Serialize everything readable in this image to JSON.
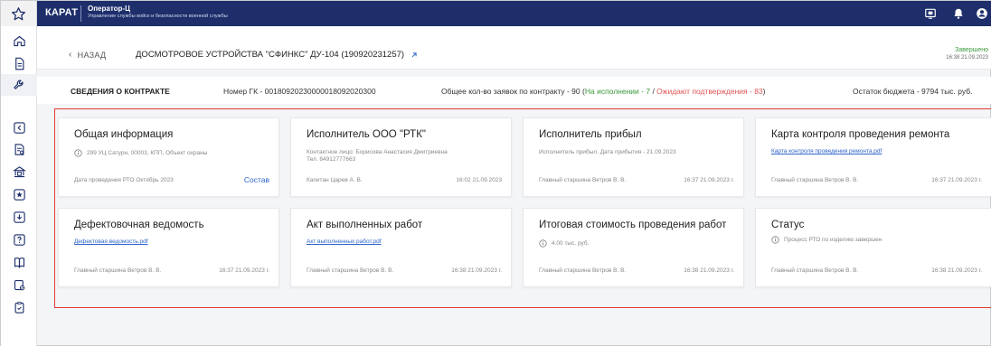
{
  "brand": "КАРАТ",
  "app": {
    "title": "Оператор-Ц",
    "subtitle": "Управление службы войск и безопасности военной службы"
  },
  "header": {
    "back_label": "НАЗАД",
    "title": "ДОСМОТРОВОЕ УСТРОЙСТВА \"СФИНКС\" ДУ-104 (190920231257)",
    "status": "Завершено",
    "status_time": "16:38 21.09.2023"
  },
  "contract": {
    "title": "СВЕДЕНИЯ О КОНТРАКТЕ",
    "number": "Номер ГК - 00180920230000018092020300",
    "total_prefix": "Общее кол-во заявок по контракту - 90 (",
    "in_progress": "На исполнении - 7",
    "sep": " / ",
    "awaiting": "Ожидают подтверждения - 83",
    "total_suffix": ")",
    "budget": "Остаток бюджета - 9794 тыс. руб."
  },
  "cards": [
    {
      "title": "Общая информация",
      "line": "299 УЦ Сатурн, 00003, КПП, Объект охраны",
      "foot_left": "Дата проведения РТО Октябрь 2023",
      "foot_link": "Состав"
    },
    {
      "title": "Исполнитель ООО \"РТК\"",
      "line": "Контактное лицо: Борисова Анастасия Дмитриевна",
      "line2": "Тел. 84912777663",
      "foot_left": "Капитан Царев А. В.",
      "foot_right": "16:02 21.09.2023"
    },
    {
      "title": "Исполнитель прибыл",
      "line": "Исполнитель прибыл. Дата прибытия - 21.09.2023",
      "foot_left": "Главный старшина Ветров В. В.",
      "foot_right": "16:37 21.09.2023 г."
    },
    {
      "title": "Карта контроля проведения ремонта",
      "link": "Карта контроля проведения ремонта.pdf",
      "foot_left": "Главный старшина Ветров В. В.",
      "foot_right": "16:37 21.09.2023 г."
    },
    {
      "title": "Дефектовочная ведомость",
      "link": "Дефектовая ведомость.pdf",
      "foot_left": "Главный старшина Ветров В. В.",
      "foot_right": "16:37 21.09.2023 г."
    },
    {
      "title": "Акт выполненных работ",
      "link": "Акт выполненных работ.pdf",
      "foot_left": "Главный старшина Ветров В. В.",
      "foot_right": "16:38 21.09.2023 г."
    },
    {
      "title": "Итоговая стоимость проведения работ",
      "line": "4.00 тыс. руб.",
      "foot_left": "Главный старшина Ветров В. В.",
      "foot_right": "16:38 21.09.2023 г."
    },
    {
      "title": "Статус",
      "line": "Процесс РТО по изделию завершен",
      "foot_left": "Главный старшина Ветров В. В.",
      "foot_right": "16:38 21.09.2023 г."
    }
  ],
  "colors": {
    "topbar": "#1d2e6b",
    "accent_link": "#2d63c8",
    "success": "#3a9a3a",
    "warning": "#e05555",
    "highlight": "#e53935"
  },
  "icons": {
    "topbar": [
      "star-icon",
      "display-icon",
      "bell-icon",
      "user-icon"
    ],
    "sidebar": [
      "home-icon",
      "document-icon",
      "wrench-icon",
      "back-square-icon",
      "report-icon",
      "bank-icon",
      "star-square-icon",
      "download-square-icon",
      "help-square-icon",
      "book-icon",
      "checklist-icon",
      "clipboard-icon"
    ]
  }
}
